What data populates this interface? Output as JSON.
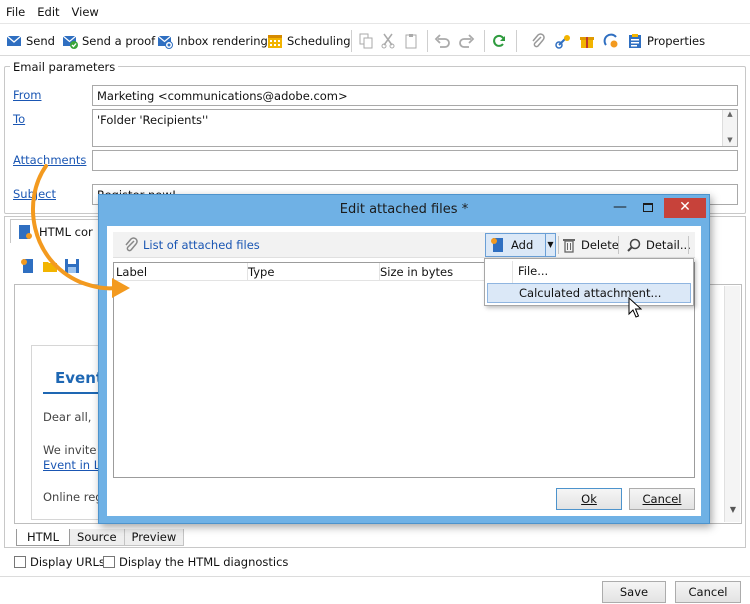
{
  "menu": [
    "File",
    "Edit",
    "View"
  ],
  "toolbar": {
    "send": "Send",
    "send_proof": "Send a proof",
    "inbox_rendering": "Inbox rendering",
    "scheduling": "Scheduling",
    "properties": "Properties"
  },
  "email_params": {
    "legend": "Email parameters",
    "from_label": "From",
    "from_value": "Marketing <communications@adobe.com>",
    "to_label": "To",
    "to_value": "'Folder 'Recipients''",
    "attachments_label": "Attachments",
    "attachments_value": "",
    "subject_label": "Subject",
    "subject_value": "Register now!"
  },
  "content": {
    "tab_label": "HTML cor",
    "preview_heading": "Event",
    "dear": "Dear all,",
    "we_invite": "We invite",
    "event_link": "Event in Lo",
    "online_reg": "Online reg"
  },
  "bottom_tabs": [
    "HTML",
    "Source",
    "Preview"
  ],
  "checkboxes": {
    "display_urls": "Display URLs",
    "html_diagnostics": "Display the HTML diagnostics"
  },
  "footer": {
    "save": "Save",
    "cancel": "Cancel"
  },
  "dialog": {
    "title": "Edit attached files *",
    "list_label": "List of attached files",
    "add": "Add",
    "delete": "Delete",
    "detail": "Detail...",
    "columns": [
      "Label",
      "Type",
      "Size in bytes"
    ],
    "ok": "Ok",
    "cancel": "Cancel"
  },
  "dropdown": {
    "items": [
      "File...",
      "Calculated attachment..."
    ],
    "highlighted_index": 1
  },
  "colors": {
    "accent_blue": "#1a56b3",
    "dialog_frame": "#6fb1e5",
    "arrow_orange": "#f39a1f",
    "close_red": "#c7423a"
  }
}
